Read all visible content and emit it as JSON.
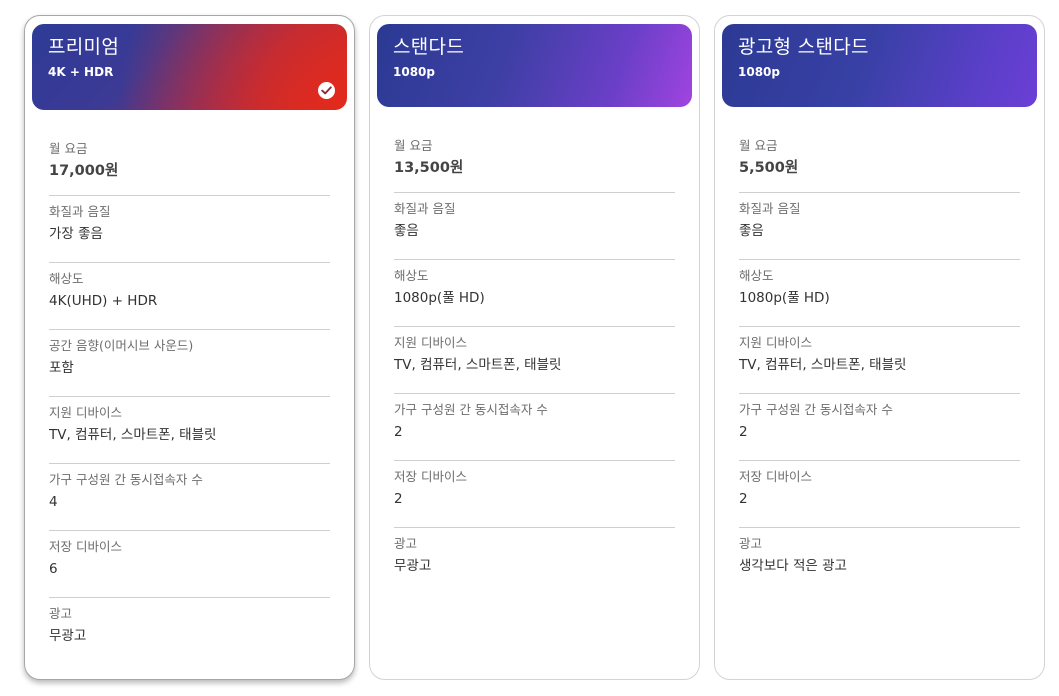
{
  "plans": [
    {
      "name": "프리미엄",
      "resolution": "4K + HDR",
      "selected": true,
      "rows": [
        {
          "label": "월 요금",
          "value": "17,000원"
        },
        {
          "label": "화질과 음질",
          "value": "가장 좋음"
        },
        {
          "label": "해상도",
          "value": "4K(UHD) + HDR"
        },
        {
          "label": "공간 음향(이머시브 사운드)",
          "value": "포함"
        },
        {
          "label": "지원 디바이스",
          "value": "TV, 컴퓨터, 스마트폰, 태블릿"
        },
        {
          "label": "가구 구성원 간 동시접속자 수",
          "value": "4"
        },
        {
          "label": "저장 디바이스",
          "value": "6"
        },
        {
          "label": "광고",
          "value": "무광고"
        }
      ]
    },
    {
      "name": "스탠다드",
      "resolution": "1080p",
      "selected": false,
      "rows": [
        {
          "label": "월 요금",
          "value": "13,500원"
        },
        {
          "label": "화질과 음질",
          "value": "좋음"
        },
        {
          "label": "해상도",
          "value": "1080p(풀 HD)"
        },
        {
          "label": "지원 디바이스",
          "value": "TV, 컴퓨터, 스마트폰, 태블릿"
        },
        {
          "label": "가구 구성원 간 동시접속자 수",
          "value": "2"
        },
        {
          "label": "저장 디바이스",
          "value": "2"
        },
        {
          "label": "광고",
          "value": "무광고"
        }
      ]
    },
    {
      "name": "광고형 스탠다드",
      "resolution": "1080p",
      "selected": false,
      "rows": [
        {
          "label": "월 요금",
          "value": "5,500원"
        },
        {
          "label": "화질과 음질",
          "value": "좋음"
        },
        {
          "label": "해상도",
          "value": "1080p(풀 HD)"
        },
        {
          "label": "지원 디바이스",
          "value": "TV, 컴퓨터, 스마트폰, 태블릿"
        },
        {
          "label": "가구 구성원 간 동시접속자 수",
          "value": "2"
        },
        {
          "label": "저장 디바이스",
          "value": "2"
        },
        {
          "label": "광고",
          "value": "생각보다 적은 광고"
        }
      ]
    }
  ],
  "icons": {
    "selected": "checkmark-circle-icon"
  },
  "colors": {
    "premium_accent": "#c9302c",
    "standard_accent": "#a044e0",
    "ads_accent": "#6b3fd6"
  }
}
